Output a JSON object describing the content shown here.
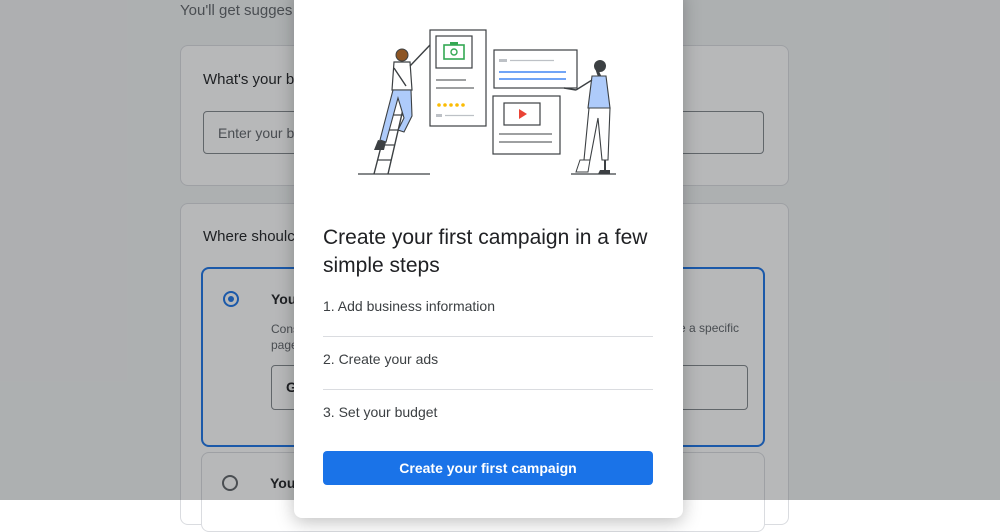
{
  "background": {
    "intro_text": "You'll get sugges",
    "budget_card": {
      "title": "What's your b",
      "input_placeholder": "Enter your bu"
    },
    "where_card": {
      "title": "Where shoulc",
      "option_1": {
        "title": "You",
        "description": "Cons",
        "description_line2": "page",
        "description_right": "e a specific",
        "url_value": "G"
      },
      "option_2": {
        "title": "You"
      }
    }
  },
  "dialog": {
    "title": "Create your first campaign in a few simple steps",
    "steps": [
      {
        "label": "1. Add business information"
      },
      {
        "label": "2. Create your ads"
      },
      {
        "label": "3. Set your budget"
      }
    ],
    "cta_label": "Create your first campaign"
  },
  "colors": {
    "primary": "#1a73e8",
    "text": "#202124",
    "divider": "#dadce0"
  }
}
